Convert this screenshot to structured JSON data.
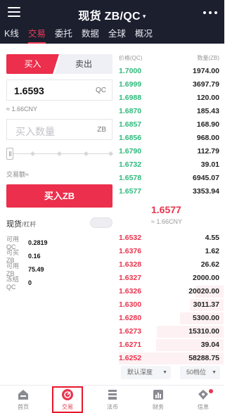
{
  "header": {
    "title": "现货 ZB/QC",
    "caret": "▾"
  },
  "tabs": [
    {
      "label": "K线"
    },
    {
      "label": "交易"
    },
    {
      "label": "委托"
    },
    {
      "label": "数据"
    },
    {
      "label": "全球"
    },
    {
      "label": "概况"
    }
  ],
  "trade": {
    "buy_label": "买入",
    "sell_label": "卖出",
    "price_value": "1.6593",
    "price_unit": "QC",
    "price_cny": "≈ 1.66CNY",
    "qty_placeholder": "买入数量",
    "qty_unit": "ZB",
    "amount_label": "交易额≈",
    "submit_label": "买入ZB",
    "margin_label": "现货",
    "margin_sub": "/杠杆"
  },
  "balances": [
    {
      "label": "可用 QC",
      "value": "0.2819"
    },
    {
      "label": "可买 ZB",
      "value": "0.16"
    },
    {
      "label": "可用 ZB",
      "value": "75.49"
    },
    {
      "label": "冻结 QC",
      "value": "0"
    }
  ],
  "orderbook": {
    "price_header": "价格(QC)",
    "amount_header": "数量(ZB)",
    "asks": [
      {
        "price": "1.7000",
        "amount": "1974.00"
      },
      {
        "price": "1.6999",
        "amount": "3697.79"
      },
      {
        "price": "1.6988",
        "amount": "120.00"
      },
      {
        "price": "1.6870",
        "amount": "185.43"
      },
      {
        "price": "1.6857",
        "amount": "168.90"
      },
      {
        "price": "1.6856",
        "amount": "968.00"
      },
      {
        "price": "1.6790",
        "amount": "112.79"
      },
      {
        "price": "1.6732",
        "amount": "39.01"
      },
      {
        "price": "1.6578",
        "amount": "6945.07"
      },
      {
        "price": "1.6577",
        "amount": "3353.94"
      }
    ],
    "last_price": "1.6577",
    "last_price_cny": "≈ 1.66CNY",
    "bids": [
      {
        "price": "1.6532",
        "amount": "4.55"
      },
      {
        "price": "1.6376",
        "amount": "1.62"
      },
      {
        "price": "1.6328",
        "amount": "26.62"
      },
      {
        "price": "1.6327",
        "amount": "2000.00"
      },
      {
        "price": "1.6326",
        "amount": "20020.00"
      },
      {
        "price": "1.6300",
        "amount": "3011.37"
      },
      {
        "price": "1.6280",
        "amount": "5300.00"
      },
      {
        "price": "1.6273",
        "amount": "15310.00"
      },
      {
        "price": "1.6271",
        "amount": "39.04"
      },
      {
        "price": "1.6252",
        "amount": "58288.75"
      }
    ],
    "depth_select": "默认深度",
    "levels_select": "50档位"
  },
  "bottom_nav": [
    {
      "label": "首页",
      "icon": "home-icon"
    },
    {
      "label": "交易",
      "icon": "trade-icon"
    },
    {
      "label": "法币",
      "icon": "fiat-icon"
    },
    {
      "label": "财务",
      "icon": "finance-icon"
    },
    {
      "label": "信息",
      "icon": "info-icon"
    }
  ],
  "colors": {
    "buy_red": "#ec2f4c",
    "ask_green": "#2fb97c",
    "bid_red": "#e8354e",
    "header_bg": "#1b1f2e"
  }
}
